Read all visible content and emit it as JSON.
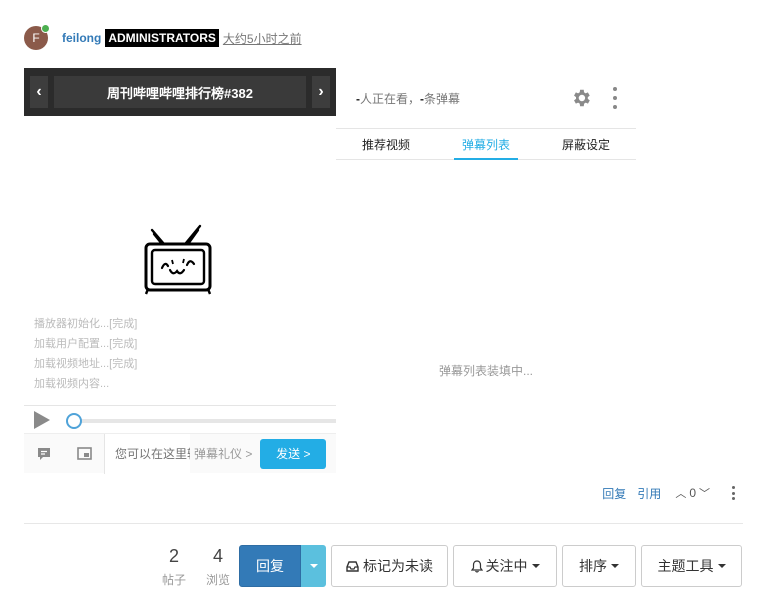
{
  "post": {
    "avatar_letter": "F",
    "username": "feilong",
    "group": "ADMINISTRATORS",
    "timeago": "大约5小时之前"
  },
  "player": {
    "prev_label": "‹",
    "next_label": "›",
    "title": "周刊哔哩哔哩排行榜#382",
    "loading_messages": [
      "播放器初始化...[完成]",
      "加载用户配置...[完成]",
      "加载视频地址...[完成]",
      "加载视频内容..."
    ],
    "progress": 0,
    "input_placeholder": "您可以在这里输入弹幕吐槽哦~",
    "gift_label": "弹幕礼仪 >",
    "send_label": "发送 >"
  },
  "side_panel": {
    "viewer_count": "-",
    "viewer_text": "人正在看，",
    "danmaku_count": "-",
    "danmaku_text": "条弹幕",
    "tabs": [
      "推荐视频",
      "弹幕列表",
      "屏蔽设定"
    ],
    "active_tab": 1,
    "loading_text": "弹幕列表装填中..."
  },
  "post_actions": {
    "reply": "回复",
    "quote": "引用",
    "votes": "0"
  },
  "topic_stats": {
    "posts_count": "2",
    "posts_label": "帖子",
    "views_count": "4",
    "views_label": "浏览"
  },
  "toolbar": {
    "reply": "回复",
    "mark_unread": "标记为未读",
    "watching": "关注中",
    "sort": "排序",
    "topic_tools": "主题工具"
  },
  "colors": {
    "accent": "#23ade5",
    "primary": "#337ab7",
    "online": "#4caf50"
  }
}
